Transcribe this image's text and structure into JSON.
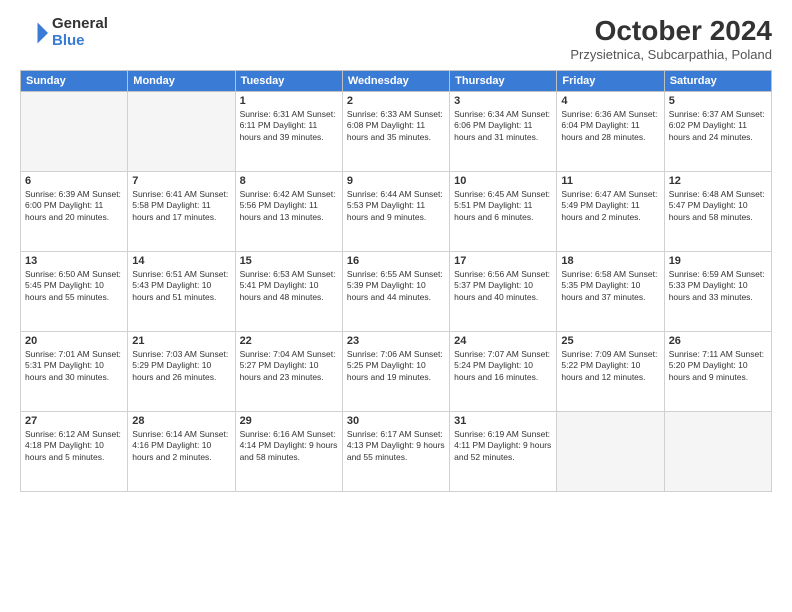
{
  "logo": {
    "general": "General",
    "blue": "Blue"
  },
  "header": {
    "title": "October 2024",
    "subtitle": "Przysietnica, Subcarpathia, Poland"
  },
  "columns": [
    "Sunday",
    "Monday",
    "Tuesday",
    "Wednesday",
    "Thursday",
    "Friday",
    "Saturday"
  ],
  "weeks": [
    [
      {
        "day": "",
        "detail": ""
      },
      {
        "day": "",
        "detail": ""
      },
      {
        "day": "1",
        "detail": "Sunrise: 6:31 AM\nSunset: 6:11 PM\nDaylight: 11 hours and 39 minutes."
      },
      {
        "day": "2",
        "detail": "Sunrise: 6:33 AM\nSunset: 6:08 PM\nDaylight: 11 hours and 35 minutes."
      },
      {
        "day": "3",
        "detail": "Sunrise: 6:34 AM\nSunset: 6:06 PM\nDaylight: 11 hours and 31 minutes."
      },
      {
        "day": "4",
        "detail": "Sunrise: 6:36 AM\nSunset: 6:04 PM\nDaylight: 11 hours and 28 minutes."
      },
      {
        "day": "5",
        "detail": "Sunrise: 6:37 AM\nSunset: 6:02 PM\nDaylight: 11 hours and 24 minutes."
      }
    ],
    [
      {
        "day": "6",
        "detail": "Sunrise: 6:39 AM\nSunset: 6:00 PM\nDaylight: 11 hours and 20 minutes."
      },
      {
        "day": "7",
        "detail": "Sunrise: 6:41 AM\nSunset: 5:58 PM\nDaylight: 11 hours and 17 minutes."
      },
      {
        "day": "8",
        "detail": "Sunrise: 6:42 AM\nSunset: 5:56 PM\nDaylight: 11 hours and 13 minutes."
      },
      {
        "day": "9",
        "detail": "Sunrise: 6:44 AM\nSunset: 5:53 PM\nDaylight: 11 hours and 9 minutes."
      },
      {
        "day": "10",
        "detail": "Sunrise: 6:45 AM\nSunset: 5:51 PM\nDaylight: 11 hours and 6 minutes."
      },
      {
        "day": "11",
        "detail": "Sunrise: 6:47 AM\nSunset: 5:49 PM\nDaylight: 11 hours and 2 minutes."
      },
      {
        "day": "12",
        "detail": "Sunrise: 6:48 AM\nSunset: 5:47 PM\nDaylight: 10 hours and 58 minutes."
      }
    ],
    [
      {
        "day": "13",
        "detail": "Sunrise: 6:50 AM\nSunset: 5:45 PM\nDaylight: 10 hours and 55 minutes."
      },
      {
        "day": "14",
        "detail": "Sunrise: 6:51 AM\nSunset: 5:43 PM\nDaylight: 10 hours and 51 minutes."
      },
      {
        "day": "15",
        "detail": "Sunrise: 6:53 AM\nSunset: 5:41 PM\nDaylight: 10 hours and 48 minutes."
      },
      {
        "day": "16",
        "detail": "Sunrise: 6:55 AM\nSunset: 5:39 PM\nDaylight: 10 hours and 44 minutes."
      },
      {
        "day": "17",
        "detail": "Sunrise: 6:56 AM\nSunset: 5:37 PM\nDaylight: 10 hours and 40 minutes."
      },
      {
        "day": "18",
        "detail": "Sunrise: 6:58 AM\nSunset: 5:35 PM\nDaylight: 10 hours and 37 minutes."
      },
      {
        "day": "19",
        "detail": "Sunrise: 6:59 AM\nSunset: 5:33 PM\nDaylight: 10 hours and 33 minutes."
      }
    ],
    [
      {
        "day": "20",
        "detail": "Sunrise: 7:01 AM\nSunset: 5:31 PM\nDaylight: 10 hours and 30 minutes."
      },
      {
        "day": "21",
        "detail": "Sunrise: 7:03 AM\nSunset: 5:29 PM\nDaylight: 10 hours and 26 minutes."
      },
      {
        "day": "22",
        "detail": "Sunrise: 7:04 AM\nSunset: 5:27 PM\nDaylight: 10 hours and 23 minutes."
      },
      {
        "day": "23",
        "detail": "Sunrise: 7:06 AM\nSunset: 5:25 PM\nDaylight: 10 hours and 19 minutes."
      },
      {
        "day": "24",
        "detail": "Sunrise: 7:07 AM\nSunset: 5:24 PM\nDaylight: 10 hours and 16 minutes."
      },
      {
        "day": "25",
        "detail": "Sunrise: 7:09 AM\nSunset: 5:22 PM\nDaylight: 10 hours and 12 minutes."
      },
      {
        "day": "26",
        "detail": "Sunrise: 7:11 AM\nSunset: 5:20 PM\nDaylight: 10 hours and 9 minutes."
      }
    ],
    [
      {
        "day": "27",
        "detail": "Sunrise: 6:12 AM\nSunset: 4:18 PM\nDaylight: 10 hours and 5 minutes."
      },
      {
        "day": "28",
        "detail": "Sunrise: 6:14 AM\nSunset: 4:16 PM\nDaylight: 10 hours and 2 minutes."
      },
      {
        "day": "29",
        "detail": "Sunrise: 6:16 AM\nSunset: 4:14 PM\nDaylight: 9 hours and 58 minutes."
      },
      {
        "day": "30",
        "detail": "Sunrise: 6:17 AM\nSunset: 4:13 PM\nDaylight: 9 hours and 55 minutes."
      },
      {
        "day": "31",
        "detail": "Sunrise: 6:19 AM\nSunset: 4:11 PM\nDaylight: 9 hours and 52 minutes."
      },
      {
        "day": "",
        "detail": ""
      },
      {
        "day": "",
        "detail": ""
      }
    ]
  ]
}
